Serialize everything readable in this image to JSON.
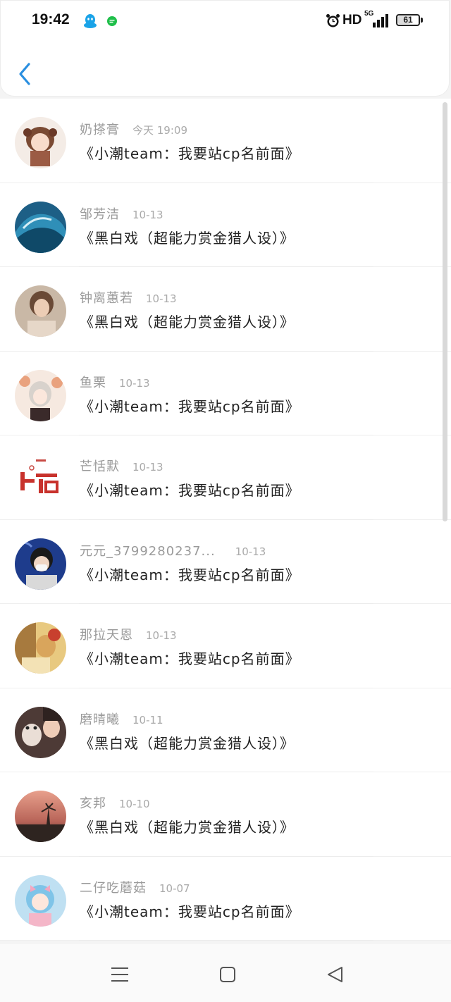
{
  "status_bar": {
    "time": "19:42",
    "network": "HD",
    "network_type": "5G",
    "battery": "61",
    "battery_level": 0.61,
    "icons": [
      "qq-icon",
      "message-icon",
      "alarm-icon",
      "signal-icon",
      "battery-icon"
    ]
  },
  "toolbar": {
    "back_icon": "chevron-left-icon",
    "accent": "#2a8fe0"
  },
  "list": {
    "items": [
      {
        "name": "奶搽膏",
        "date": "今天 19:09",
        "title": "《小潮team：我要站cp名前面》"
      },
      {
        "name": "邹芳洁",
        "date": "10-13",
        "title": "《黑白戏（超能力赏金猎人设）》"
      },
      {
        "name": "钟离蕙若",
        "date": "10-13",
        "title": "《黑白戏（超能力赏金猎人设）》"
      },
      {
        "name": "鱼栗",
        "date": "10-13",
        "title": "《小潮team：我要站cp名前面》"
      },
      {
        "name": "芒恬默",
        "date": "10-13",
        "title": "《小潮team：我要站cp名前面》"
      },
      {
        "name": "元元_3799280237...",
        "date": "10-13",
        "title": "《小潮team：我要站cp名前面》"
      },
      {
        "name": "那拉天恩",
        "date": "10-13",
        "title": "《小潮team：我要站cp名前面》"
      },
      {
        "name": "磨晴曦",
        "date": "10-11",
        "title": "《黑白戏（超能力赏金猎人设）》"
      },
      {
        "name": "亥邦",
        "date": "10-10",
        "title": "《黑白戏（超能力赏金猎人设）》"
      },
      {
        "name": "二仔吃蘑菇",
        "date": "10-07",
        "title": "《小潮team：我要站cp名前面》"
      }
    ]
  },
  "nav_bar": {
    "icons": [
      "menu-icon",
      "home-square-icon",
      "back-triangle-icon"
    ]
  }
}
